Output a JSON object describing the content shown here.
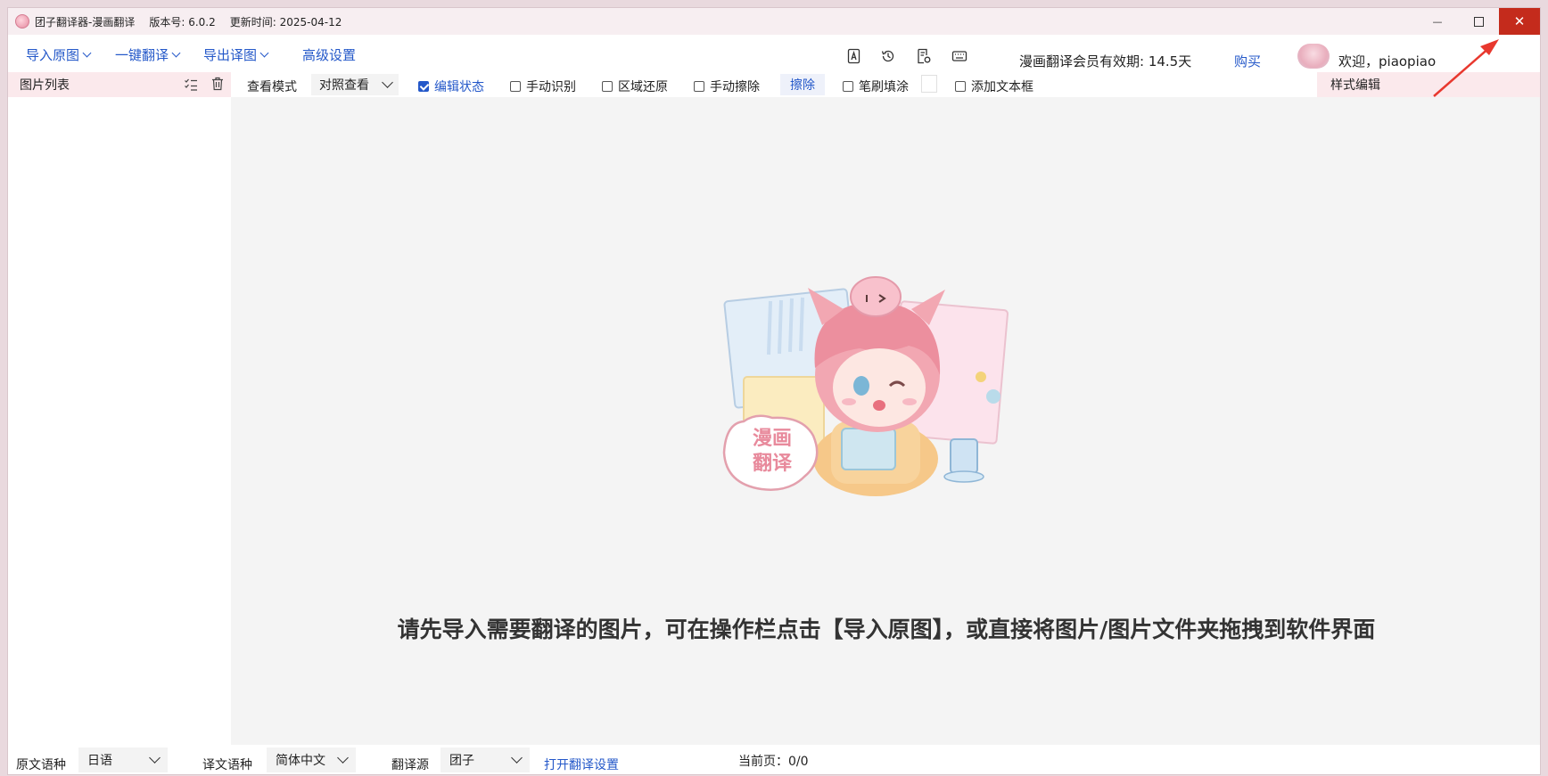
{
  "title_bar": {
    "app_title": "团子翻译器-漫画翻译",
    "version": "版本号: 6.0.2",
    "updated": "更新时间: 2025-04-12",
    "minimize_glyph": "—",
    "close_glyph": "✕"
  },
  "menu": {
    "import": "导入原图",
    "one_click": "一键翻译",
    "export": "导出译图",
    "advanced": "高级设置"
  },
  "header_right": {
    "icons": [
      "font-icon",
      "history-icon",
      "document-settings-icon",
      "keyboard-icon"
    ],
    "membership": "漫画翻译会员有效期: 14.5天",
    "buy": "购买",
    "welcome": "欢迎，piaopiao"
  },
  "left_panel": {
    "title": "图片列表"
  },
  "toolbar": {
    "view_mode_label": "查看模式",
    "view_mode_value": "对照查看",
    "edit_state": "编辑状态",
    "manual_ocr": "手动识别",
    "region_restore": "区域还原",
    "manual_erase": "手动擦除",
    "erase_button": "擦除",
    "brush_fill": "笔刷填涂",
    "add_textbox": "添加文本框",
    "edit_state_checked": true
  },
  "style_panel": {
    "title": "样式编辑"
  },
  "canvas": {
    "hint": "请先导入需要翻译的图片，可在操作栏点击【导入原图】，或直接将图片/图片文件夹拖拽到软件界面",
    "badge_line1": "漫画",
    "badge_line2": "翻译"
  },
  "bottom_bar": {
    "source_lang_label": "原文语种",
    "source_lang_value": "日语",
    "target_lang_label": "译文语种",
    "target_lang_value": "简体中文",
    "engine_label": "翻译源",
    "engine_value": "团子",
    "open_settings": "打开翻译设置",
    "page_label": "当前页：",
    "page_value": "0/0"
  },
  "colors": {
    "accent": "#2458c9",
    "close_red": "#c42b1c",
    "panel_pink": "#fbe9ec",
    "annotation_arrow": "#e8382e"
  }
}
